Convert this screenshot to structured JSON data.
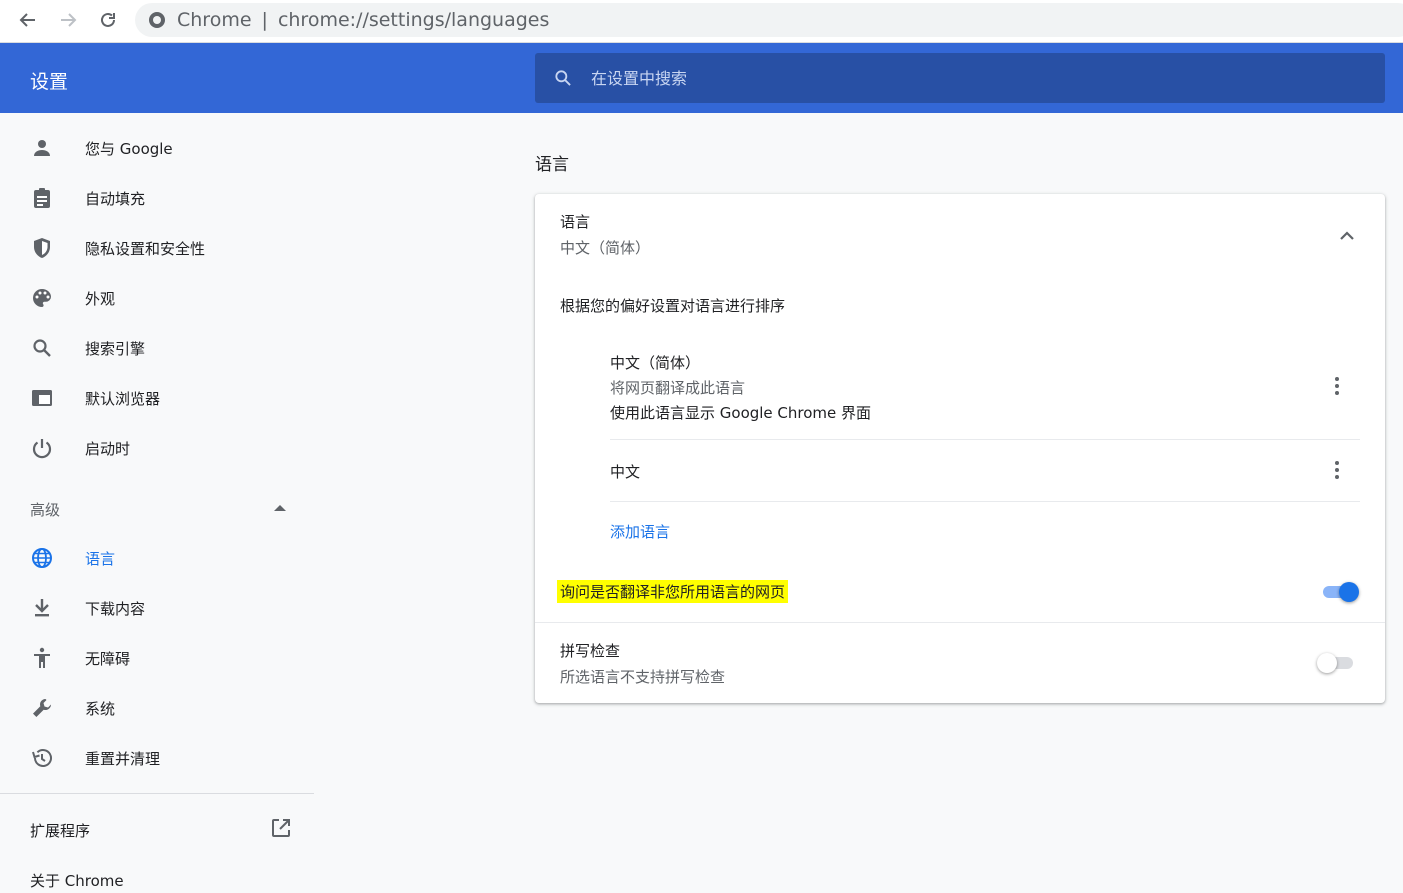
{
  "browser": {
    "back_glyph": "←",
    "forward_glyph": "→",
    "reload_glyph": "⟳",
    "scheme_label": "Chrome",
    "separator": "|",
    "url": "chrome://settings/languages"
  },
  "header": {
    "title": "设置",
    "search_placeholder": "在设置中搜索",
    "bg_color": "#3367d6"
  },
  "sidebar": {
    "items": [
      {
        "label": "您与 Google",
        "icon": "person-icon"
      },
      {
        "label": "自动填充",
        "icon": "clipboard-icon"
      },
      {
        "label": "隐私设置和安全性",
        "icon": "shield-icon"
      },
      {
        "label": "外观",
        "icon": "palette-icon"
      },
      {
        "label": "搜索引擎",
        "icon": "search-icon"
      },
      {
        "label": "默认浏览器",
        "icon": "browser-window-icon"
      },
      {
        "label": "启动时",
        "icon": "power-icon"
      }
    ],
    "advanced_label": "高级",
    "advanced_items": [
      {
        "label": "语言",
        "icon": "globe-icon",
        "active": true
      },
      {
        "label": "下载内容",
        "icon": "download-icon"
      },
      {
        "label": "无障碍",
        "icon": "accessibility-icon"
      },
      {
        "label": "系统",
        "icon": "wrench-icon"
      },
      {
        "label": "重置并清理",
        "icon": "history-icon"
      }
    ],
    "extensions_label": "扩展程序",
    "about_label": "关于 Chrome"
  },
  "main": {
    "heading": "语言",
    "card": {
      "title": "语言",
      "subtitle": "中文（简体）",
      "order_text": "根据您的偏好设置对语言进行排序",
      "languages": [
        {
          "name": "中文（简体）",
          "sub": "将网页翻译成此语言",
          "note": "使用此语言显示 Google Chrome 界面"
        },
        {
          "name": "中文"
        }
      ],
      "add_language": "添加语言",
      "translate_offer": {
        "label": "询问是否翻译非您所用语言的网页",
        "enabled": true
      },
      "spellcheck": {
        "title": "拼写检查",
        "subtitle": "所选语言不支持拼写检查",
        "enabled": false
      }
    }
  },
  "colors": {
    "accent": "#1a73e8",
    "highlight": "#ffff00"
  }
}
